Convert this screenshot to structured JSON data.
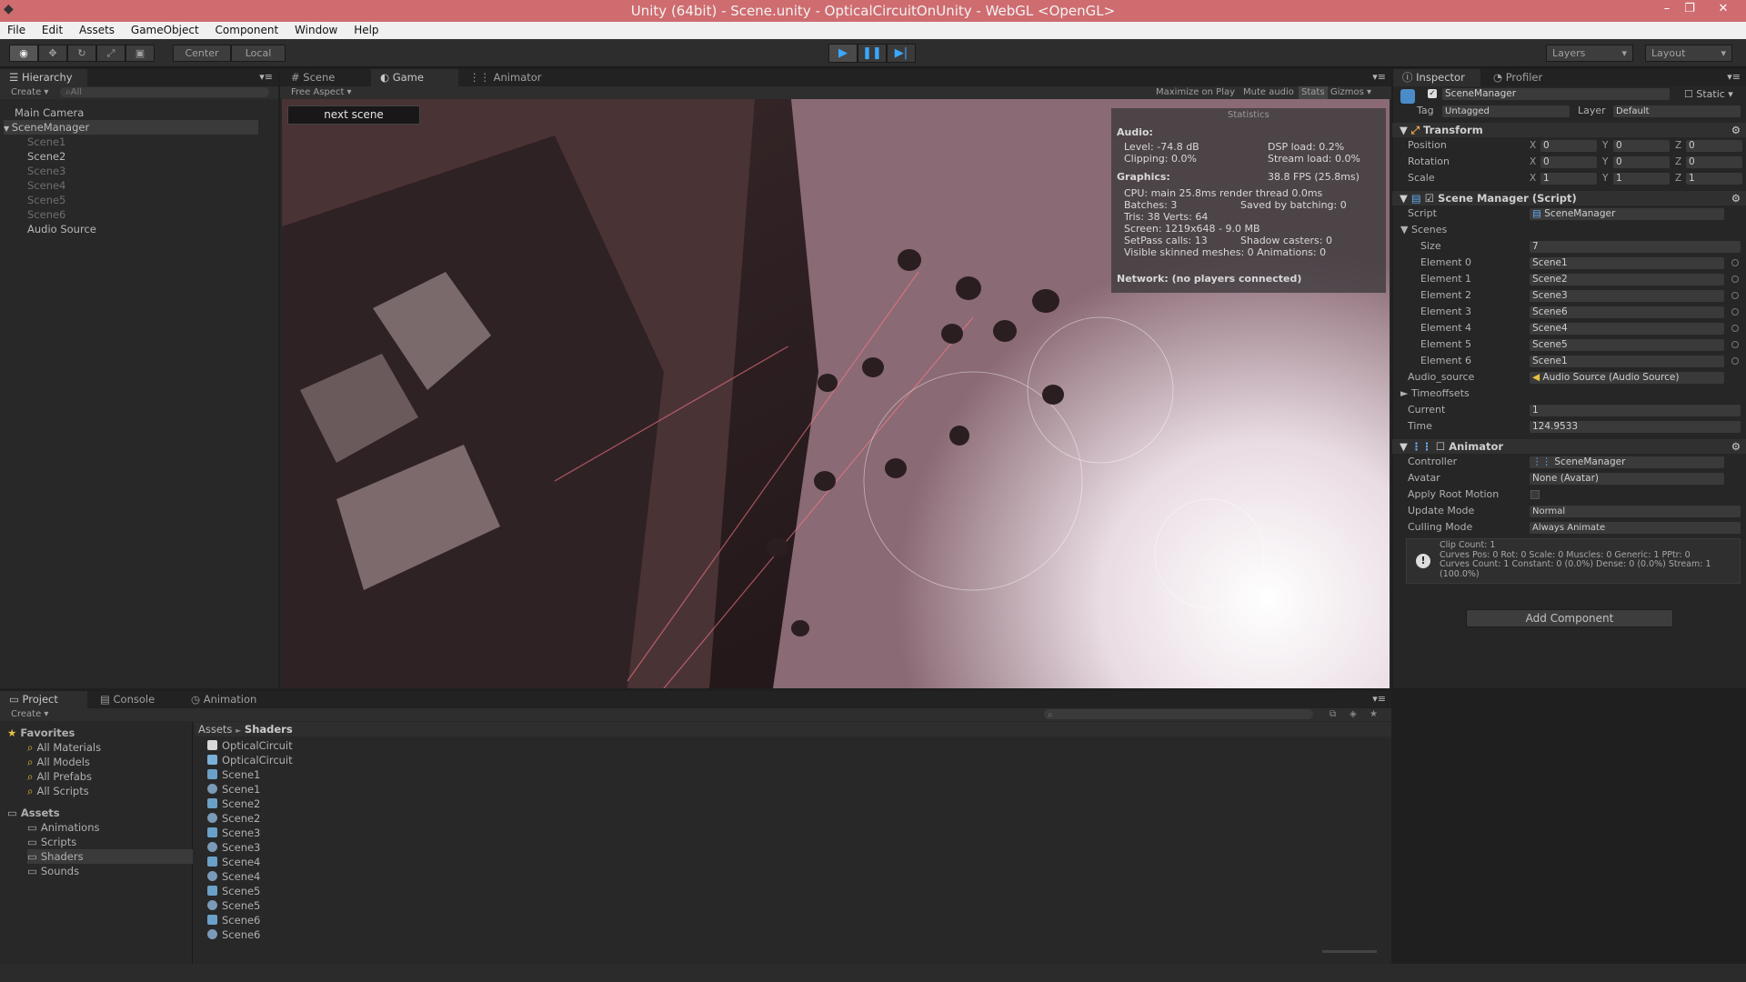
{
  "window": {
    "title": "Unity (64bit) - Scene.unity - OpticalCircuitOnUnity - WebGL <OpenGL>",
    "controls": [
      "–",
      "❐",
      "✕"
    ]
  },
  "menu": [
    "File",
    "Edit",
    "Assets",
    "GameObject",
    "Component",
    "Window",
    "Help"
  ],
  "toolbar": {
    "center_label": "Center",
    "local_label": "Local",
    "layers_label": "Layers",
    "layout_label": "Layout"
  },
  "hierarchy": {
    "tab": "Hierarchy",
    "create": "Create",
    "search_placeholder": "All",
    "items": [
      {
        "label": "Main Camera",
        "indent": 0,
        "disabled": false
      },
      {
        "label": "SceneManager",
        "indent": 0,
        "disabled": false,
        "expanded": true
      },
      {
        "label": "Scene1",
        "indent": 1,
        "disabled": true
      },
      {
        "label": "Scene2",
        "indent": 1,
        "disabled": false
      },
      {
        "label": "Scene3",
        "indent": 1,
        "disabled": true
      },
      {
        "label": "Scene4",
        "indent": 1,
        "disabled": true
      },
      {
        "label": "Scene5",
        "indent": 1,
        "disabled": true
      },
      {
        "label": "Scene6",
        "indent": 1,
        "disabled": true
      },
      {
        "label": "Audio Source",
        "indent": 1,
        "disabled": false
      }
    ]
  },
  "view_tabs": {
    "scene": "Scene",
    "game": "Game",
    "animator": "Animator",
    "aspect": "Free Aspect",
    "maximize": "Maximize on Play",
    "mute": "Mute audio",
    "stats": "Stats",
    "gizmos": "Gizmos"
  },
  "game": {
    "next_button": "next scene"
  },
  "stats": {
    "title": "Statistics",
    "audio": "Audio:",
    "level": "Level: -74.8 dB",
    "clipping": "Clipping: 0.0%",
    "dsp": "DSP load: 0.2%",
    "stream": "Stream load: 0.0%",
    "graphics": "Graphics:",
    "fps": "38.8 FPS (25.8ms)",
    "cpu": "CPU: main 25.8ms  render thread 0.0ms",
    "batches": "Batches: 3",
    "saved": "Saved by batching: 0",
    "tris": "Tris: 38   Verts: 64",
    "screen": "Screen: 1219x648 - 9.0 MB",
    "setpass": "SetPass calls: 13",
    "shadow": "Shadow casters: 0",
    "skinned": "Visible skinned meshes: 0  Animations: 0",
    "network": "Network: (no players connected)"
  },
  "inspector": {
    "tab": "Inspector",
    "profiler_tab": "Profiler",
    "object_name": "SceneManager",
    "static": "Static",
    "tag_label": "Tag",
    "tag": "Untagged",
    "layer_label": "Layer",
    "layer": "Default",
    "transform": {
      "title": "Transform",
      "position_label": "Position",
      "rotation_label": "Rotation",
      "scale_label": "Scale",
      "position": [
        "0",
        "0",
        "0"
      ],
      "rotation": [
        "0",
        "0",
        "0"
      ],
      "scale": [
        "1",
        "1",
        "1"
      ]
    },
    "scene_manager": {
      "title": "Scene Manager (Script)",
      "script_label": "Script",
      "script": "SceneManager",
      "scenes_label": "Scenes",
      "size_label": "Size",
      "size": "7",
      "elements": [
        {
          "label": "Element 0",
          "value": "Scene1"
        },
        {
          "label": "Element 1",
          "value": "Scene2"
        },
        {
          "label": "Element 2",
          "value": "Scene3"
        },
        {
          "label": "Element 3",
          "value": "Scene6"
        },
        {
          "label": "Element 4",
          "value": "Scene4"
        },
        {
          "label": "Element 5",
          "value": "Scene5"
        },
        {
          "label": "Element 6",
          "value": "Scene1"
        }
      ],
      "audio_label": "Audio_source",
      "audio": "Audio Source (Audio Source)",
      "timeoffsets": "Timeoffsets",
      "current_label": "Current",
      "current": "1",
      "time_label": "Time",
      "time": "124.9533"
    },
    "animator": {
      "title": "Animator",
      "controller_label": "Controller",
      "controller": "SceneManager",
      "avatar_label": "Avatar",
      "avatar": "None (Avatar)",
      "root_label": "Apply Root Motion",
      "update_label": "Update Mode",
      "update": "Normal",
      "culling_label": "Culling Mode",
      "culling": "Always Animate",
      "info1": "Clip Count: 1",
      "info2": "Curves Pos: 0 Rot: 0 Scale: 0 Muscles: 0 Generic: 1 PPtr: 0",
      "info3": "Curves Count: 1 Constant: 0 (0.0%) Dense: 0 (0.0%) Stream: 1",
      "info4": "(100.0%)"
    },
    "add_component": "Add Component"
  },
  "project": {
    "tab": "Project",
    "console_tab": "Console",
    "animation_tab": "Animation",
    "create": "Create",
    "breadcrumb_root": "Assets",
    "breadcrumb_sep": "►",
    "breadcrumb_leaf": "Shaders",
    "favorites_label": "Favorites",
    "favorites": [
      "All Materials",
      "All Models",
      "All Prefabs",
      "All Scripts"
    ],
    "assets_label": "Assets",
    "folders": [
      "Animations",
      "Scripts",
      "Shaders",
      "Sounds"
    ],
    "files": [
      {
        "label": "OpticalCircuit",
        "kind": "doc"
      },
      {
        "label": "OpticalCircuit",
        "kind": "code"
      },
      {
        "label": "Scene1",
        "kind": "shader"
      },
      {
        "label": "Scene1",
        "kind": "mat"
      },
      {
        "label": "Scene2",
        "kind": "shader"
      },
      {
        "label": "Scene2",
        "kind": "mat"
      },
      {
        "label": "Scene3",
        "kind": "shader"
      },
      {
        "label": "Scene3",
        "kind": "mat"
      },
      {
        "label": "Scene4",
        "kind": "shader"
      },
      {
        "label": "Scene4",
        "kind": "mat"
      },
      {
        "label": "Scene5",
        "kind": "shader"
      },
      {
        "label": "Scene5",
        "kind": "mat"
      },
      {
        "label": "Scene6",
        "kind": "shader"
      },
      {
        "label": "Scene6",
        "kind": "mat"
      }
    ]
  },
  "colors": {
    "titlebar": "#cf6c70",
    "accent": "#3aa8ff",
    "panel": "#282828"
  }
}
